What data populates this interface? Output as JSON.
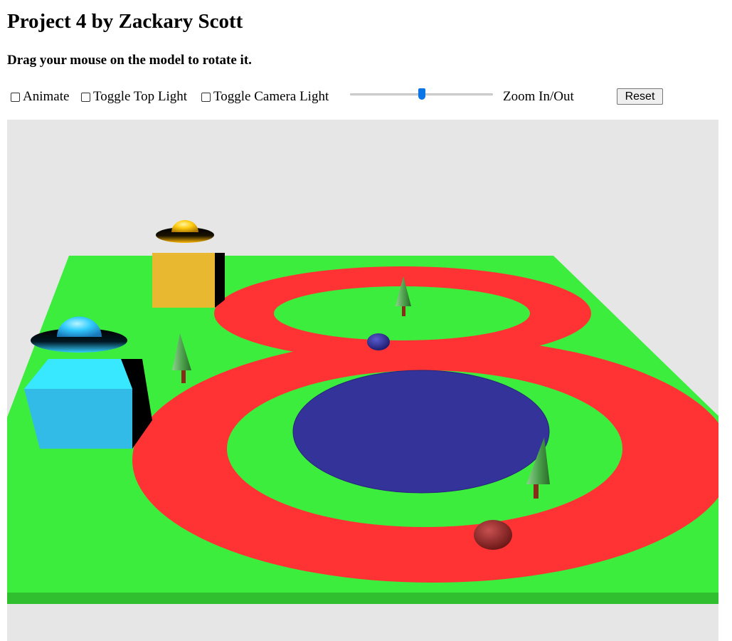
{
  "page": {
    "title": "Project 4 by Zackary Scott",
    "instructions": "Drag your mouse on the model to rotate it."
  },
  "controls": {
    "animate_label": "Animate",
    "animate_checked": false,
    "top_light_label": "Toggle Top Light",
    "top_light_checked": false,
    "camera_light_label": "Toggle Camera Light",
    "camera_light_checked": false,
    "zoom_label": "Zoom In/Out",
    "zoom_value_fraction": 0.5,
    "reset_label": "Reset"
  },
  "scene": {
    "background_color": "#e6e6e6",
    "ground_color": "#3ded3d",
    "track_color": "#ff3333",
    "pond_color": "#333399",
    "cube_colors": [
      "#e8b830",
      "#33ccee"
    ],
    "ufo_dome_colors": [
      "#ffcc11",
      "#33ccff"
    ],
    "ball_colors": [
      "#2a2a8a",
      "#a52a2a"
    ],
    "tree_color": "#5aae5a",
    "objects": [
      "ground-plane",
      "figure-eight-track",
      "pond",
      "yellow-cube",
      "cyan-cube",
      "yellow-ufo",
      "cyan-ufo",
      "trees",
      "blue-ball",
      "red-ball"
    ]
  }
}
